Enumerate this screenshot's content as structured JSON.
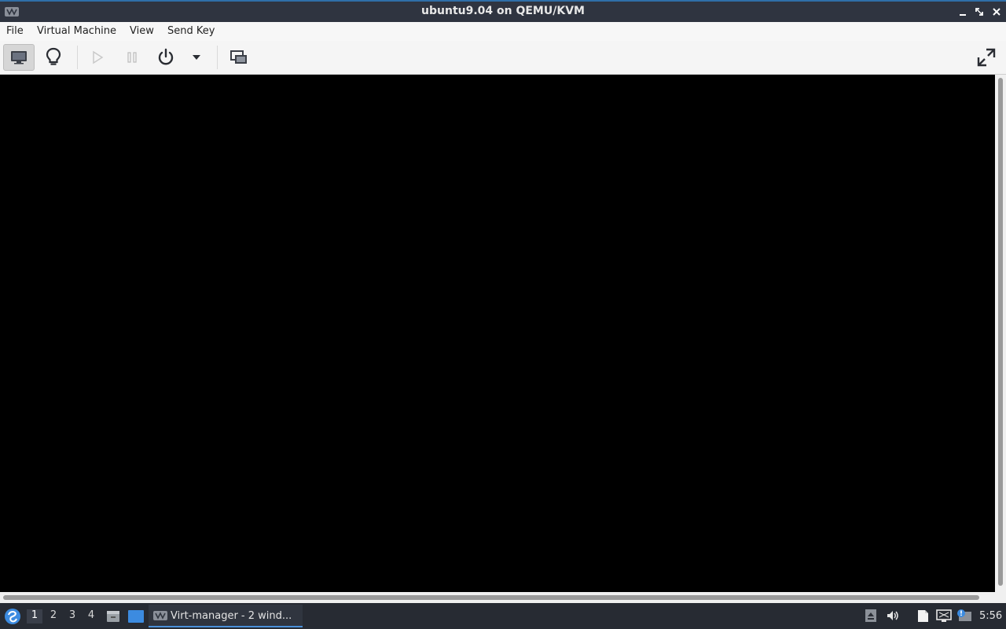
{
  "window": {
    "title": "ubuntu9.04 on QEMU/KVM",
    "controls": {
      "minimize": "minimize",
      "maximize": "maximize",
      "close": "close"
    }
  },
  "menubar": {
    "items": [
      {
        "label": "File"
      },
      {
        "label": "Virtual Machine"
      },
      {
        "label": "View"
      },
      {
        "label": "Send Key"
      }
    ]
  },
  "toolbar": {
    "buttons": [
      {
        "name": "console",
        "icon": "monitor-icon",
        "active": true,
        "enabled": true
      },
      {
        "name": "details",
        "icon": "lightbulb-icon",
        "active": false,
        "enabled": true
      },
      {
        "name": "run",
        "icon": "play-icon",
        "active": false,
        "enabled": false
      },
      {
        "name": "pause",
        "icon": "pause-icon",
        "active": false,
        "enabled": false
      },
      {
        "name": "shutdown",
        "icon": "power-icon",
        "active": false,
        "enabled": true
      },
      {
        "name": "shutdown-menu",
        "icon": "chevron-down-icon",
        "active": false,
        "enabled": true
      },
      {
        "name": "snapshots",
        "icon": "snapshot-icon",
        "active": false,
        "enabled": true
      },
      {
        "name": "fullscreen",
        "icon": "fullscreen-icon",
        "active": false,
        "enabled": true
      }
    ]
  },
  "taskbar": {
    "workspaces": [
      "1",
      "2",
      "3",
      "4"
    ],
    "current_workspace": "1",
    "task_label": "Virt-manager - 2 wind...",
    "clock": "5:56",
    "colors": {
      "accent": "#4a90d9",
      "panel": "#272b33"
    }
  }
}
